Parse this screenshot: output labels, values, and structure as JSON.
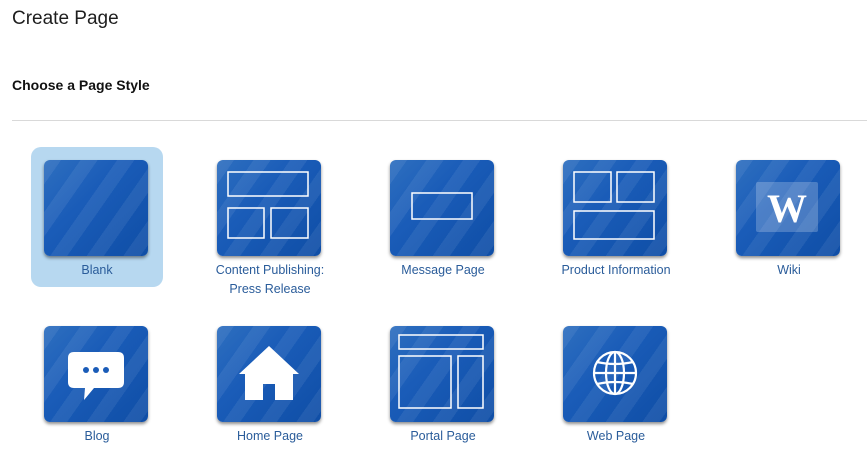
{
  "header": {
    "title": "Create Page"
  },
  "section": {
    "title": "Choose a Page Style"
  },
  "styles": [
    {
      "label": "Blank",
      "icon": "blank-icon",
      "selected": true
    },
    {
      "label": "Content Publishing:\nPress Release",
      "icon": "content-publishing-icon",
      "selected": false
    },
    {
      "label": "Message Page",
      "icon": "message-page-icon",
      "selected": false
    },
    {
      "label": "Product Information",
      "icon": "product-information-icon",
      "selected": false
    },
    {
      "label": "Wiki",
      "icon": "wiki-icon",
      "selected": false
    },
    {
      "label": "Blog",
      "icon": "blog-icon",
      "selected": false
    },
    {
      "label": "Home Page",
      "icon": "home-icon",
      "selected": false
    },
    {
      "label": "Portal Page",
      "icon": "portal-page-icon",
      "selected": false
    },
    {
      "label": "Web Page",
      "icon": "web-page-icon",
      "selected": false
    }
  ],
  "wiki_glyph": "W",
  "colors": {
    "accent": "#1a5cb8",
    "selected_bg": "#b7d8f0",
    "label": "#2a5c9a"
  }
}
